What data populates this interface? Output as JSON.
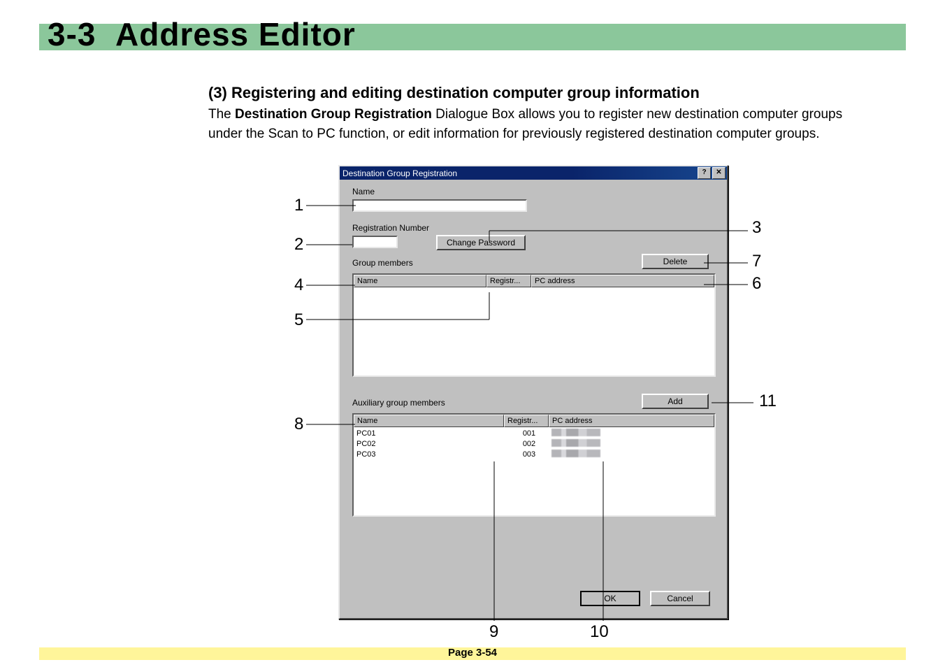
{
  "section_number": "3-3",
  "section_title": "Address Editor",
  "subsection_title": "(3) Registering and editing destination computer group information",
  "body_prefix": "The ",
  "body_bold": "Destination Group Registration",
  "body_rest": " Dialogue Box allows you to register new destination computer groups under the Scan to PC function, or edit information for previously registered destination computer groups.",
  "dialog": {
    "title": "Destination Group Registration",
    "name_label": "Name",
    "reg_label": "Registration Number",
    "change_pw": "Change Password",
    "group_members": "Group members",
    "aux_members": "Auxiliary group members",
    "delete": "Delete",
    "add": "Add",
    "ok": "OK",
    "cancel": "Cancel",
    "col_name": "Name",
    "col_reg": "Registr...",
    "col_pc": "PC address"
  },
  "aux_rows": [
    {
      "name": "PC01",
      "reg": "001"
    },
    {
      "name": "PC02",
      "reg": "002"
    },
    {
      "name": "PC03",
      "reg": "003"
    }
  ],
  "callouts": {
    "c1": "1",
    "c2": "2",
    "c3": "3",
    "c4": "4",
    "c5": "5",
    "c6": "6",
    "c7": "7",
    "c8": "8",
    "c9": "9",
    "c10": "10",
    "c11": "11"
  },
  "page_number": "Page 3-54"
}
